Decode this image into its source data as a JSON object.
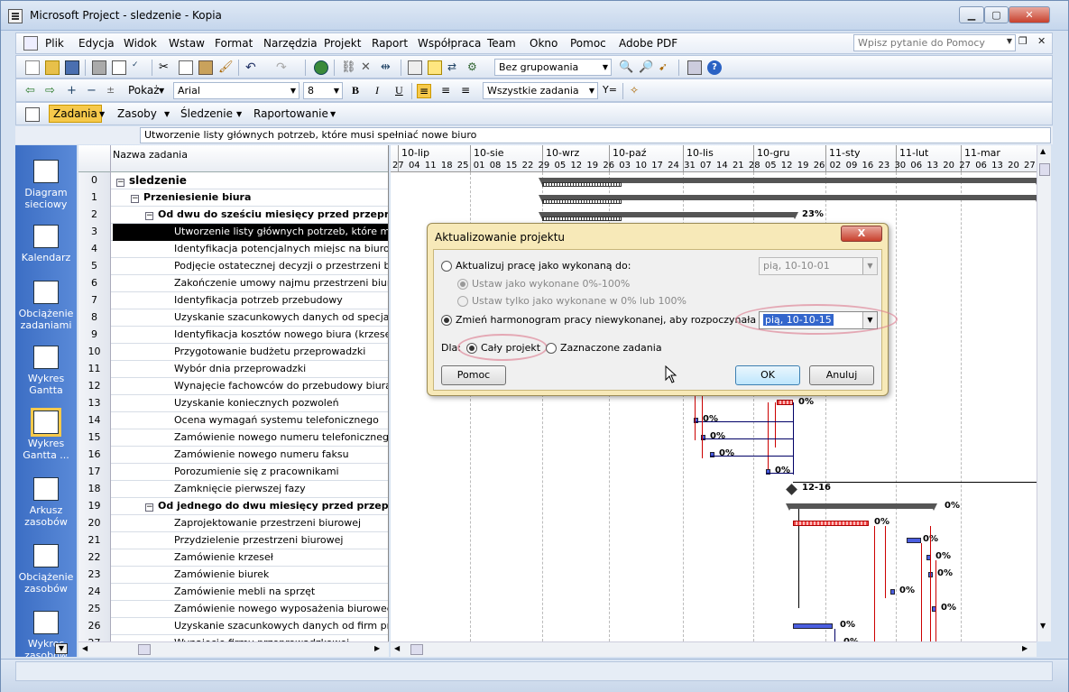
{
  "window": {
    "title": "Microsoft Project - sledzenie - Kopia"
  },
  "menu": [
    "Plik",
    "Edycja",
    "Widok",
    "Wstaw",
    "Format",
    "Narzędzia",
    "Projekt",
    "Raport",
    "Współpraca",
    "Team",
    "Okno",
    "Pomoc",
    "Adobe PDF"
  ],
  "help_placeholder": "Wpisz pytanie do Pomocy",
  "toolbar1": {
    "grouping": "Bez grupowania"
  },
  "toolbar2": {
    "show_label": "Pokaż",
    "font": "Arial",
    "size": "8",
    "bold": "B",
    "italic": "I",
    "underline": "U",
    "filter": "Wszystkie zadania"
  },
  "toolbar3": {
    "tasks": "Zadania",
    "resources": "Zasoby",
    "tracking": "Śledzenie",
    "reporting": "Raportowanie"
  },
  "entry_bar": {
    "value": "Utworzenie listy głównych potrzeb, które musi spełniać nowe biuro"
  },
  "view_bar": [
    {
      "label": "Diagram sieciowy",
      "icon": "network-diagram-icon"
    },
    {
      "label": "Kalendarz",
      "icon": "calendar-icon"
    },
    {
      "label": "Obciążenie zadaniami",
      "icon": "task-usage-icon"
    },
    {
      "label": "Wykres Gantta",
      "icon": "gantt-chart-icon"
    },
    {
      "label": "Wykres Gantta ...",
      "icon": "tracking-gantt-icon"
    },
    {
      "label": "Arkusz zasobów",
      "icon": "resource-sheet-icon"
    },
    {
      "label": "Obciążenie zasobów",
      "icon": "resource-usage-icon"
    },
    {
      "label": "Wykres zasobów",
      "icon": "resource-graph-icon"
    }
  ],
  "grid": {
    "column_header": "Nazwa zadania",
    "rows": [
      {
        "id": "0",
        "name": "sledzenie",
        "level": 0,
        "summary": true
      },
      {
        "id": "1",
        "name": "Przeniesienie biura",
        "level": 1,
        "summary": true
      },
      {
        "id": "2",
        "name": "Od dwu do sześciu miesięcy przed przeprowadzką",
        "level": 2,
        "summary": true
      },
      {
        "id": "3",
        "name": "Utworzenie listy głównych potrzeb, które musi spełniać nowe biuro",
        "level": 3,
        "selected": true
      },
      {
        "id": "4",
        "name": "Identyfikacja potencjalnych miejsc na biuro",
        "level": 3
      },
      {
        "id": "5",
        "name": "Podjęcie ostatecznej decyzji o przestrzeni biurowej",
        "level": 3
      },
      {
        "id": "6",
        "name": "Zakończenie umowy najmu przestrzeni biurowej",
        "level": 3
      },
      {
        "id": "7",
        "name": "Identyfikacja potrzeb przebudowy",
        "level": 3
      },
      {
        "id": "8",
        "name": "Uzyskanie szacunkowych danych od specjalistów",
        "level": 3
      },
      {
        "id": "9",
        "name": "Identyfikacja kosztów nowego biura (krzeseł, biurek)",
        "level": 3
      },
      {
        "id": "10",
        "name": "Przygotowanie budżetu przeprowadzki",
        "level": 3
      },
      {
        "id": "11",
        "name": "Wybór dnia przeprowadzki",
        "level": 3
      },
      {
        "id": "12",
        "name": "Wynajęcie fachowców do przebudowy biura",
        "level": 3
      },
      {
        "id": "13",
        "name": "Uzyskanie koniecznych pozwoleń",
        "level": 3
      },
      {
        "id": "14",
        "name": "Ocena wymagań systemu telefonicznego",
        "level": 3
      },
      {
        "id": "15",
        "name": "Zamówienie nowego numeru telefonicznego",
        "level": 3
      },
      {
        "id": "16",
        "name": "Zamówienie nowego numeru faksu",
        "level": 3
      },
      {
        "id": "17",
        "name": "Porozumienie się z pracownikami",
        "level": 3
      },
      {
        "id": "18",
        "name": "Zamknięcie pierwszej fazy",
        "level": 3
      },
      {
        "id": "19",
        "name": "Od jednego do dwu miesięcy przed przeprowadzką",
        "level": 2,
        "summary": true
      },
      {
        "id": "20",
        "name": "Zaprojektowanie przestrzeni biurowej",
        "level": 3
      },
      {
        "id": "21",
        "name": "Przydzielenie przestrzeni biurowej",
        "level": 3
      },
      {
        "id": "22",
        "name": "Zamówienie krzeseł",
        "level": 3
      },
      {
        "id": "23",
        "name": "Zamówienie biurek",
        "level": 3
      },
      {
        "id": "24",
        "name": "Zamówienie mebli na sprzęt",
        "level": 3
      },
      {
        "id": "25",
        "name": "Zamówienie nowego wyposażenia biurowego",
        "level": 3
      },
      {
        "id": "26",
        "name": "Uzyskanie szacunkowych danych od firm przeprowadzkowych",
        "level": 3
      },
      {
        "id": "27",
        "name": "Wynajęcie firmy przeprowadzkowej",
        "level": 3
      }
    ]
  },
  "timescale": {
    "major": [
      "10-lip",
      "10-sie",
      "10-wrz",
      "10-paź",
      "10-lis",
      "10-gru",
      "11-sty",
      "11-lut",
      "11-mar"
    ],
    "minor": [
      "27",
      "04",
      "11",
      "18",
      "25",
      "01",
      "08",
      "15",
      "22",
      "29",
      "05",
      "12",
      "19",
      "26",
      "03",
      "10",
      "17",
      "24",
      "31",
      "07",
      "14",
      "21",
      "28",
      "05",
      "12",
      "19",
      "26",
      "02",
      "09",
      "16",
      "23",
      "30",
      "06",
      "13",
      "20",
      "27",
      "06",
      "13",
      "20",
      "27"
    ]
  },
  "gantt_labels": {
    "p2": "23%",
    "p13": "0%",
    "p14": "0%",
    "p15": "0%",
    "p16": "0%",
    "p17": "0%",
    "m18": "12-16",
    "p19": "0%",
    "p20": "0%",
    "p21": "0%",
    "p22": "0%",
    "p23": "0%",
    "p24": "0%",
    "p25": "0%",
    "p26": "0%",
    "p27": "0%"
  },
  "dialog": {
    "title": "Aktualizowanie projektu",
    "close": "X",
    "opt1": "Aktualizuj pracę jako wykonaną do:",
    "opt1_date": "pią, 10-10-01",
    "opt1a": "Ustaw jako wykonane 0%-100%",
    "opt1b": "Ustaw tylko jako wykonane w 0% lub 100%",
    "opt2": "Zmień harmonogram pracy niewykonanej, aby rozpoczynała się po:",
    "opt2_date": "pią, 10-10-15",
    "for_label": "Dla:",
    "scope_all": "Cały projekt",
    "scope_sel": "Zaznaczone zadania",
    "help_btn": "Pomoc",
    "ok_btn": "OK",
    "cancel_btn": "Anuluj"
  }
}
